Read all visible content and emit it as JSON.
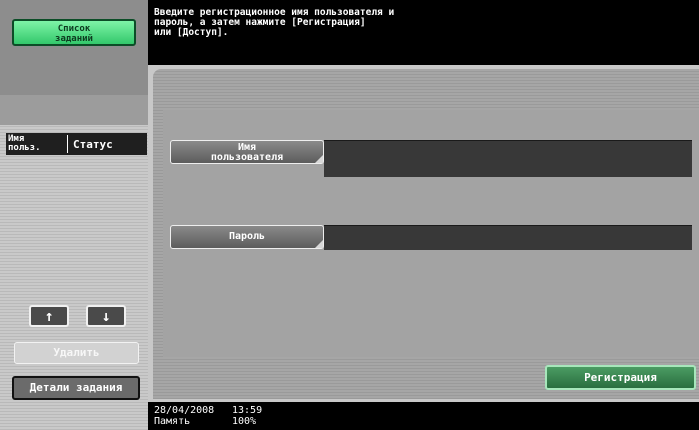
{
  "sidebar": {
    "job_list_button": "Список\nзаданий",
    "columns": {
      "user": "Имя\nпольз.",
      "status": "Статус"
    },
    "up_icon": "arrow-up-icon",
    "down_icon": "arrow-down-icon",
    "delete_button": "Удалить",
    "details_button": "Детали задания"
  },
  "message": "Введите регистрационное имя пользователя и\nпароль, а затем нажмите [Регистрация]\nили [Доступ].",
  "form": {
    "username_label": "Имя\nпользователя",
    "username_value": "",
    "password_label": "Пароль",
    "password_value": "",
    "register_button": "Регистрация"
  },
  "statusbar": {
    "date": "28/04/2008",
    "time": "13:59",
    "memory_label": "Память",
    "memory_value": "100%"
  },
  "colors": {
    "accent_green": "#33c86b",
    "register_green": "#2a6e3f"
  }
}
